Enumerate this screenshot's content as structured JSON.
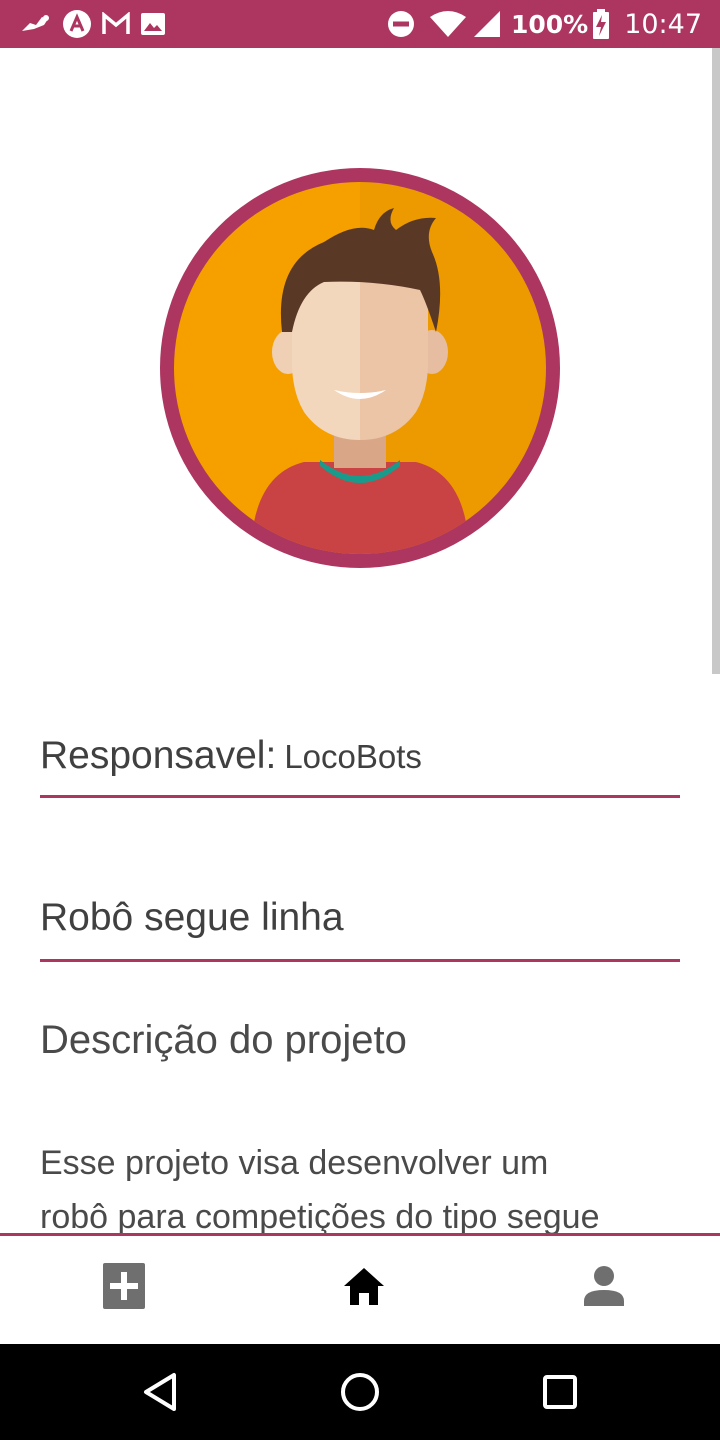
{
  "status_bar": {
    "battery": "100%",
    "time": "10:47",
    "left_icons": [
      "app-notification-icon",
      "tennis-icon",
      "gmail-icon",
      "image-icon"
    ],
    "right_icons": [
      "do-not-disturb-icon",
      "wifi-icon",
      "signal-icon",
      "battery-charging-icon"
    ]
  },
  "profile": {
    "avatar": "user-avatar-illustration"
  },
  "responsavel": {
    "label": "Responsavel:",
    "value": "LocoBots"
  },
  "project": {
    "title": "Robô segue linha",
    "description_heading": "Descrição do projeto",
    "description_line1": "Esse projeto visa desenvolver um",
    "description_line2": "robô para competições do tipo segue"
  },
  "bottom_nav": {
    "items": [
      "add-icon",
      "home-icon",
      "person-icon"
    ],
    "active": "home"
  },
  "colors": {
    "primary": "#ad3660",
    "avatar_bg": "#f6a000",
    "text": "#404040"
  }
}
